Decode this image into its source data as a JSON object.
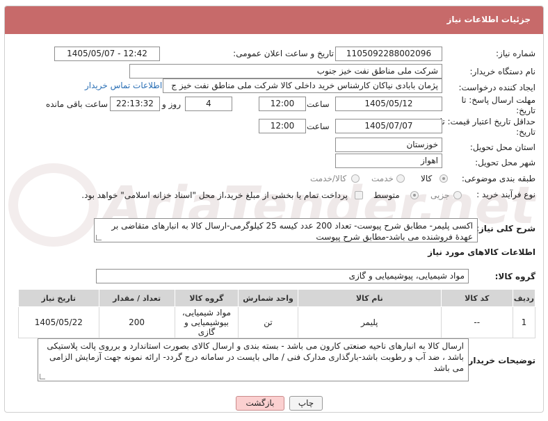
{
  "panel": {
    "title": "جزئیات اطلاعات نیاز"
  },
  "watermark": {
    "text": "AriaTender.net"
  },
  "fields": {
    "need_number_label": "شماره نیاز:",
    "need_number": "1105092288002096",
    "announce_label": "تاریخ و ساعت اعلان عمومی:",
    "announce_value": "1405/05/07 - 12:42",
    "buyer_label": "نام دستگاه خریدار:",
    "buyer_value": "شرکت ملی مناطق نفت خیز جنوب",
    "creator_label": "ایجاد کننده درخواست:",
    "creator_value": "پژمان  بابادی نیاکان  کارشناس خرید داخلی کالا  شرکت ملی مناطق نفت خیز ج",
    "contact_link": "اطلاعات تماس خریدار",
    "deadline_label": "مهلت ارسال پاسخ: تا تاریخ:",
    "deadline_date": "1405/05/12",
    "time_label": "ساعت",
    "deadline_time": "12:00",
    "days_value": "4",
    "days_label": "روز و",
    "remaining_value": "22:13:32",
    "remaining_label": "ساعت باقی مانده",
    "validity_label": "حداقل تاریخ اعتبار قیمت: تا تاریخ:",
    "validity_date": "1405/07/07",
    "validity_time": "12:00",
    "province_label": "استان محل تحویل:",
    "province_value": "خوزستان",
    "city_label": "شهر محل تحویل:",
    "city_value": "اهواز",
    "category_label": "طبقه بندی موضوعی:",
    "category_options": [
      "کالا",
      "خدمت",
      "کالا/خدمت"
    ],
    "category_selected": "کالا",
    "category_value": "کالا/خدمت",
    "process_label": "نوع فرآیند خرید :",
    "process_options": [
      "جزیی",
      "متوسط"
    ],
    "process_selected": "متوسط",
    "payment_note": "پرداخت تمام یا بخشی از مبلغ خرید،از محل \"اسناد خزانه اسلامی\" خواهد بود."
  },
  "description": {
    "label": "شرح کلی نیاز:",
    "text": "اکسی پلیمر- مطابق شرح پیوست- تعداد 200 عدد کیسه 25 کیلوگرمی-ارسال کالا به انبارهای متقاضی بر عهدهٔ فروشنده می باشد-مطابق شرح پیوست"
  },
  "goods": {
    "section_title": "اطلاعات کالاهای مورد نیاز",
    "group_label": "گروه کالا:",
    "group_value": "مواد شیمیایی، پیوشیمیایی و  گازی",
    "columns": [
      "ردیف",
      "کد کالا",
      "نام کالا",
      "واحد شمارش",
      "گروه کالا",
      "تعداد / مقدار",
      "تاریخ نیاز"
    ],
    "rows": [
      [
        "1",
        "--",
        "پلیمر",
        "تن",
        "مواد شیمیایی، بیوشیمیایی و گازی",
        "200",
        "1405/05/22"
      ]
    ]
  },
  "buyer_notes": {
    "label": "توضیحات خریدار:",
    "text": "ارسال کالا به انبارهای  ناحیه صنعتی  کارون می باشد  -  بسته بندی و ارسال کالای بصورت استاندارد و برروی پالت پلاستیکی باشد ، ضد آب و رطوبت باشد-بارگذاری مدارک فنی / مالی بایست  در سامانه درج گردد- ارائه نمونه جهت آزمایش الزامی می باشد"
  },
  "buttons": {
    "print": "چاپ",
    "back": "بازگشت"
  }
}
